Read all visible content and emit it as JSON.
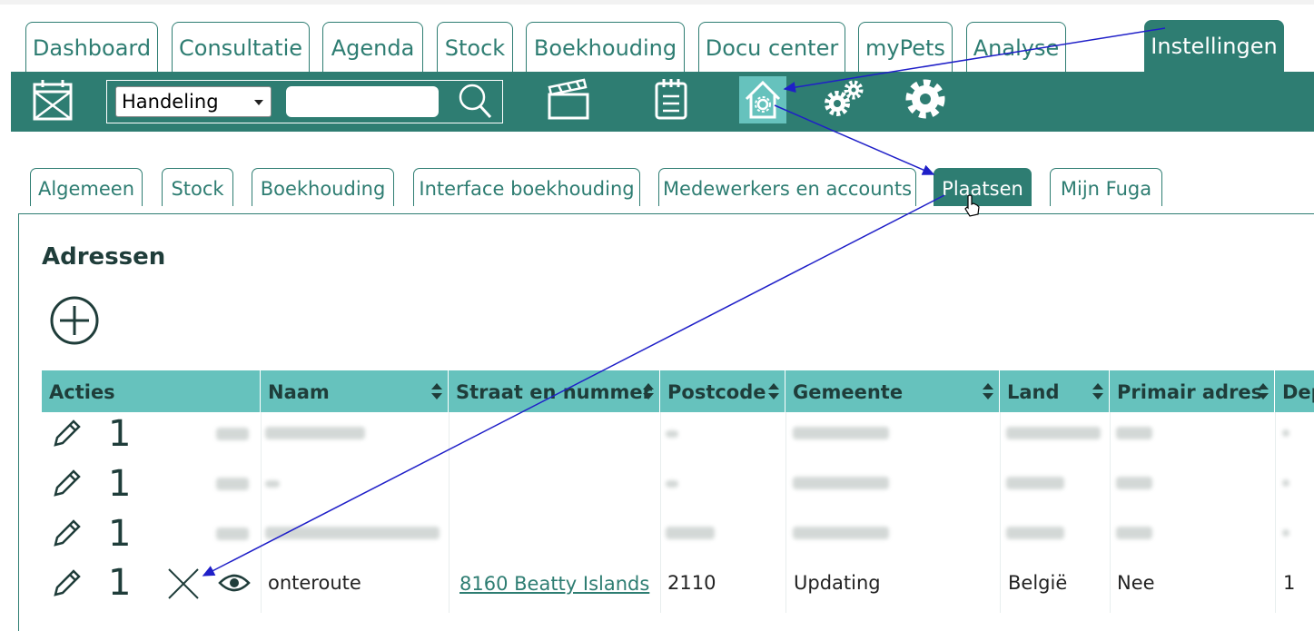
{
  "main_tabs": [
    {
      "label": "Dashboard"
    },
    {
      "label": "Consultatie"
    },
    {
      "label": "Agenda"
    },
    {
      "label": "Stock"
    },
    {
      "label": "Boekhouding"
    },
    {
      "label": "Docu center"
    },
    {
      "label": "myPets"
    },
    {
      "label": "Analyse"
    },
    {
      "label": "Instellingen",
      "active": true
    }
  ],
  "toolbar": {
    "select_value": "Handeling",
    "search_value": "",
    "icons": [
      "calendar-icon",
      "search-icon",
      "clapperboard-icon",
      "notepad-icon",
      "home-settings-icon",
      "gears-icon",
      "gear-icon"
    ]
  },
  "sub_tabs": [
    {
      "label": "Algemeen"
    },
    {
      "label": "Stock"
    },
    {
      "label": "Boekhouding"
    },
    {
      "label": "Interface boekhouding"
    },
    {
      "label": "Medewerkers en accounts"
    },
    {
      "label": "Plaatsen",
      "active": true
    },
    {
      "label": "Mijn Fuga"
    }
  ],
  "section": {
    "title": "Adressen"
  },
  "table": {
    "headers": [
      "Acties",
      "Naam",
      "Straat en nummer",
      "Postcode",
      "Gemeente",
      "Land",
      "Primair adres",
      "Dep"
    ],
    "rows": [
      {
        "count": "1",
        "blurred": true
      },
      {
        "count": "1",
        "blurred": true
      },
      {
        "count": "1",
        "blurred": true
      },
      {
        "count": "1",
        "naam": "onteroute",
        "straat": "8160 Beatty Islands",
        "postcode": "2110",
        "gemeente": "Updating",
        "land": "België",
        "primair": "Nee",
        "dep": "1"
      }
    ]
  },
  "colors": {
    "primary": "#2e7d72",
    "header": "#66c2bd",
    "annotation": "#1f1fc8"
  }
}
